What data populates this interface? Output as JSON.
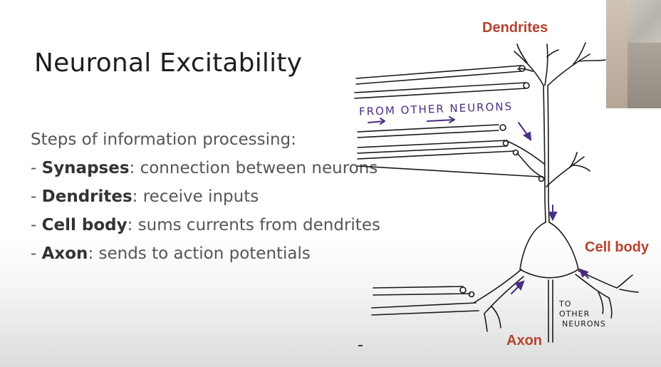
{
  "slide": {
    "title": "Neuronal Excitability",
    "intro": "Steps of information processing:",
    "bullets": [
      {
        "prefix": "- ",
        "term": "Synapses",
        "text": ": connection between neurons"
      },
      {
        "prefix": "- ",
        "term": "Dendrites",
        "text": ": receive inputs"
      },
      {
        "prefix": "- ",
        "term": "Cell body",
        "text": ": sums currents from dendrites"
      },
      {
        "prefix": "- ",
        "term": "Axon",
        "text": ": sends to action potentials"
      }
    ]
  },
  "diagram": {
    "labels": {
      "dendrites": "Dendrites",
      "cell_body": "Cell body",
      "axon": "Axon"
    },
    "handwritten": {
      "from_other_neurons": "FROM OTHER NEURONS",
      "to_other_neurons_1": "TO",
      "to_other_neurons_2": "OTHER",
      "to_other_neurons_3": "NEURONS"
    },
    "colors": {
      "label_red": "#b5432d",
      "ink": "#1a1a1a",
      "arrow_purple": "#4b2d83"
    }
  }
}
